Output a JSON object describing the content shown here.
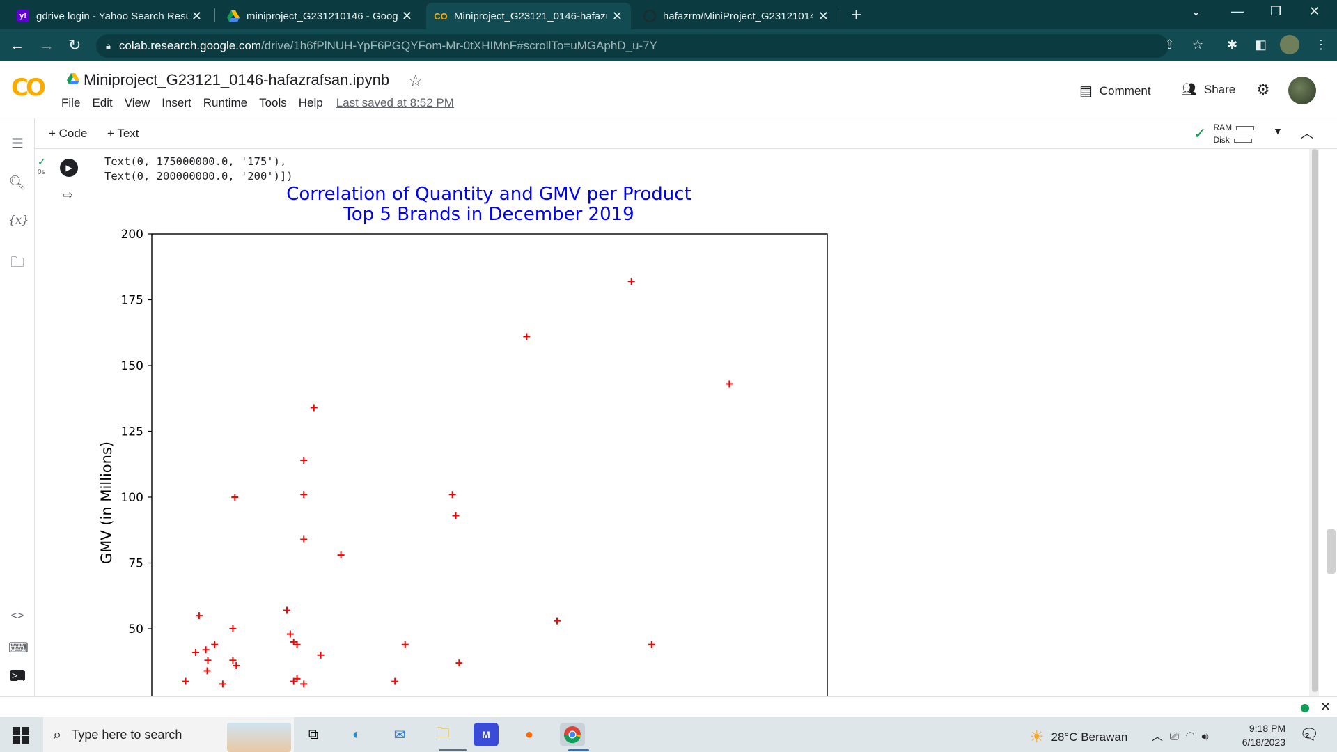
{
  "browser": {
    "tabs": [
      {
        "title": "gdrive login - Yahoo Search Resu",
        "icon": "yahoo-icon",
        "active": false
      },
      {
        "title": "miniproject_G231210146 - Googl",
        "icon": "google-drive-icon",
        "active": false
      },
      {
        "title": "Miniproject_G23121_0146-hafazr",
        "icon": "colab-icon",
        "active": true
      },
      {
        "title": "hafazrm/MiniProject_G231210146",
        "icon": "github-icon",
        "active": false
      }
    ],
    "url_host": "colab.research.google.com",
    "url_path": "/drive/1h6fPlNUH-YpF6PGQYFom-Mr-0tXHIMnF#scrollTo=uMGAphD_u-7Y"
  },
  "colab": {
    "notebook_title": "Miniproject_G23121_0146-hafazrafsan.ipynb",
    "menu": [
      "File",
      "Edit",
      "View",
      "Insert",
      "Runtime",
      "Tools",
      "Help"
    ],
    "last_saved": "Last saved at 8:52 PM",
    "comment_label": "Comment",
    "share_label": "Share",
    "add_code_label": "+ Code",
    "add_text_label": "+ Text",
    "ram_label": "RAM",
    "disk_label": "Disk",
    "cell_time": "0s",
    "code_output_lines": [
      "Text(0, 175000000.0, '175'),",
      "Text(0, 200000000.0, '200')])"
    ]
  },
  "chart_data": {
    "type": "scatter",
    "title": "Correlation of Quantity and GMV per Product\nTop 5 Brands in December 2019",
    "ylabel": "GMV (in Millions)",
    "ylim": [
      25,
      200
    ],
    "yticks": [
      50,
      75,
      100,
      125,
      150,
      175,
      200
    ],
    "ytick_labels": [
      "50",
      "75",
      "100",
      "125",
      "150",
      "175",
      "200"
    ],
    "marker": "+",
    "color": "#ff0000",
    "title_color": "#0000ff",
    "points": [
      [
        0.05,
        30
      ],
      [
        0.065,
        41
      ],
      [
        0.07,
        55
      ],
      [
        0.08,
        42
      ],
      [
        0.082,
        34
      ],
      [
        0.083,
        38
      ],
      [
        0.093,
        44
      ],
      [
        0.12,
        50
      ],
      [
        0.12,
        38
      ],
      [
        0.125,
        36
      ],
      [
        0.123,
        100
      ],
      [
        0.105,
        29
      ],
      [
        0.2,
        57
      ],
      [
        0.205,
        48
      ],
      [
        0.21,
        45
      ],
      [
        0.215,
        44
      ],
      [
        0.21,
        30
      ],
      [
        0.215,
        31
      ],
      [
        0.225,
        29
      ],
      [
        0.225,
        84
      ],
      [
        0.225,
        114
      ],
      [
        0.225,
        101
      ],
      [
        0.24,
        134
      ],
      [
        0.25,
        40
      ],
      [
        0.28,
        78
      ],
      [
        0.36,
        30
      ],
      [
        0.375,
        44
      ],
      [
        0.445,
        101
      ],
      [
        0.45,
        93
      ],
      [
        0.455,
        37
      ],
      [
        0.555,
        161
      ],
      [
        0.6,
        53
      ],
      [
        0.71,
        182
      ],
      [
        0.74,
        44
      ],
      [
        0.855,
        143
      ]
    ]
  },
  "taskbar": {
    "search_placeholder": "Type here to search",
    "weather": "28°C  Berawan",
    "time": "9:18 PM",
    "date": "6/18/2023",
    "notification_count": "2"
  }
}
